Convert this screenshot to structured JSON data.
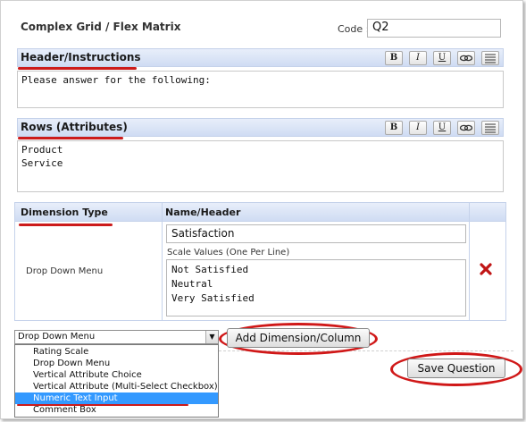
{
  "title": "Complex Grid / Flex Matrix",
  "code": {
    "label": "Code :",
    "value": "Q2"
  },
  "header_section": {
    "title": "Header/Instructions",
    "content": "Please answer for the following:"
  },
  "rows_section": {
    "title": "Rows (Attributes)",
    "content": "Product\nService"
  },
  "toolbar": {
    "bold": "B",
    "italic": "I",
    "underline": "U"
  },
  "dimension_table": {
    "col_type": "Dimension Type",
    "col_name": "Name/Header",
    "type_value": "Drop Down Menu",
    "name_value": "Satisfaction",
    "scale_label": "Scale Values (One Per Line)",
    "scale_values": "Not Satisfied\nNeutral\nVery Satisfied"
  },
  "dimension_select": {
    "selected": "Drop Down Menu",
    "options": [
      "Rating Scale",
      "Drop Down Menu",
      "Vertical Attribute Choice",
      "Vertical Attribute (Multi-Select Checkbox)",
      "Numeric Text Input",
      "Comment Box"
    ],
    "highlighted_index": 4
  },
  "add_button": "Add Dimension/Column",
  "save_button": "Save Question",
  "colors": {
    "accent_red": "#d01818",
    "header_blue": "#cfdcf3",
    "highlight": "#3399ff"
  },
  "icons": {
    "delete": "red-x-icon",
    "link": "link-icon",
    "list": "list-icon"
  }
}
